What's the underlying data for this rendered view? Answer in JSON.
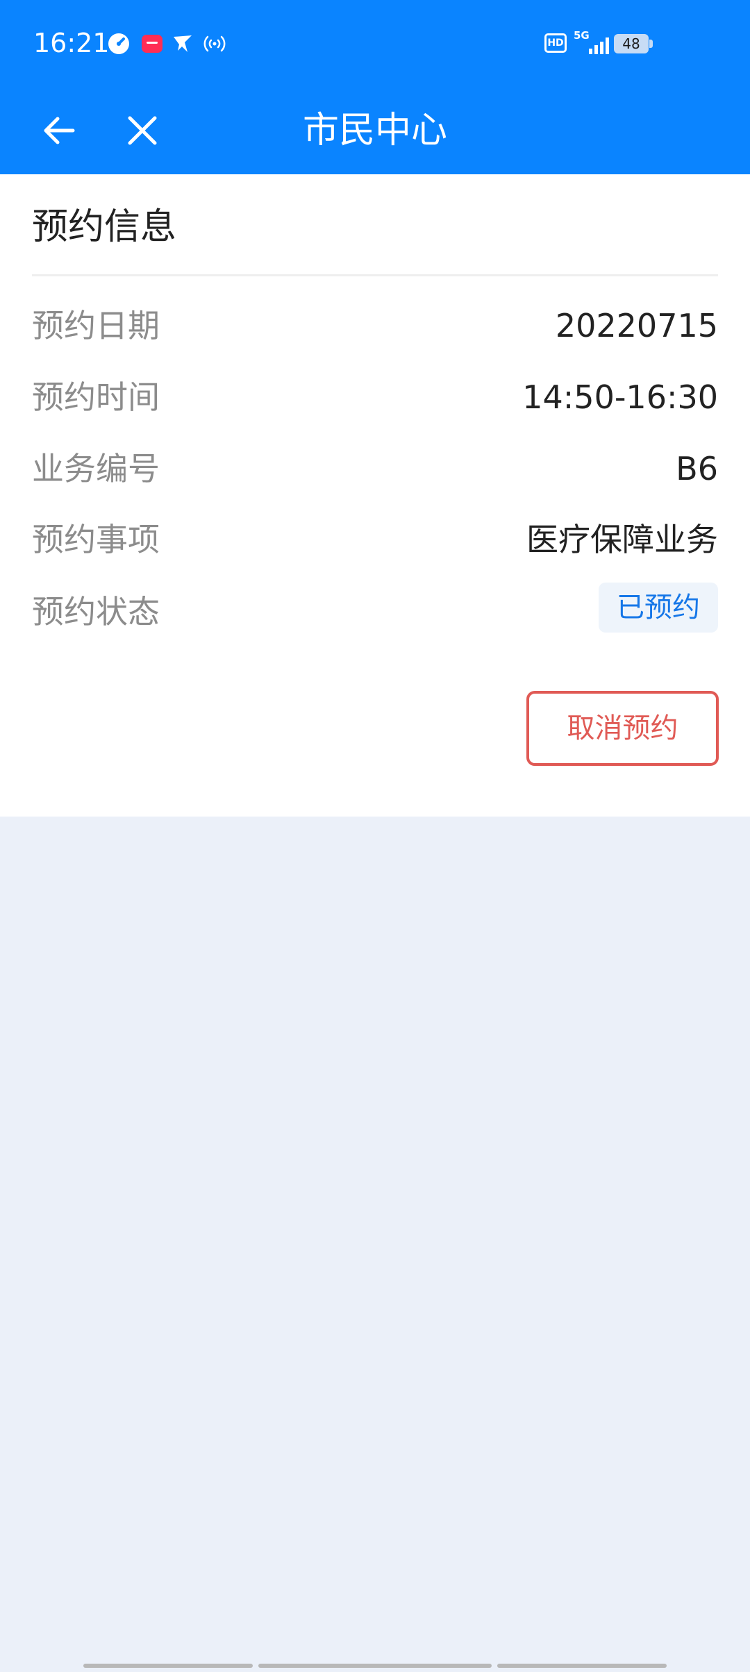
{
  "status_bar": {
    "time": "16:21",
    "left_icons": [
      "speedometer-icon",
      "shopping-bag-icon",
      "paper-plane-icon",
      "hotspot-icon"
    ],
    "hd_label": "HD",
    "network_label": "5G",
    "battery_level": "48"
  },
  "nav": {
    "title": "市民中心",
    "back_icon": "arrow-left-icon",
    "close_icon": "close-icon"
  },
  "card": {
    "title": "预约信息",
    "rows": [
      {
        "label": "预约日期",
        "value": "20220715"
      },
      {
        "label": "预约时间",
        "value": "14:50-16:30"
      },
      {
        "label": "业务编号",
        "value": "B6"
      },
      {
        "label": "预约事项",
        "value": "医疗保障业务"
      },
      {
        "label": "预约状态",
        "value": "已预约"
      }
    ],
    "cancel_label": "取消预约"
  },
  "colors": {
    "header_blue": "#0a84ff",
    "page_background": "#ebf0f9",
    "status_badge_text": "#1677e8",
    "status_badge_background": "#eef4fb",
    "cancel_red": "#e05a55"
  }
}
